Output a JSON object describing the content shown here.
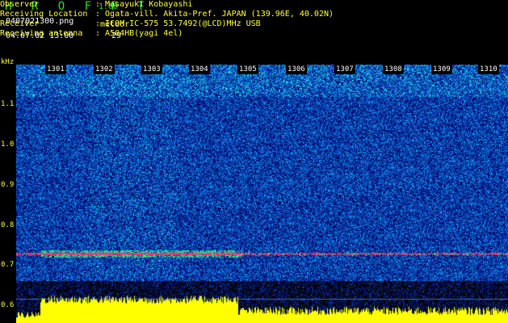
{
  "header": {
    "app_title": "H R O F F T",
    "version": "1.00",
    "filename": "0407021300.png",
    "datetime": "04.07.02 13:00",
    "meteor_label": "meteor",
    "meteor_count": "29"
  },
  "info": [
    {
      "label": "Observer",
      "value": ": Masayuki Kobayashi"
    },
    {
      "label": "Receiving Location",
      "value": ": Ogata-vill. Akita-Pref. JAPAN (139.96E, 40.02N)"
    },
    {
      "label": "Receiver",
      "value": ": ICOM IC-575 53.7492(@LCD)MHz USB"
    },
    {
      "label": "Receiving antenna",
      "value": ": A504HB(yagi 4el)"
    }
  ],
  "axis": {
    "y_unit": "kHz",
    "y_ticks": [
      "1.1",
      "1.0",
      "0.9",
      "0.8",
      "0.7",
      "0.6"
    ],
    "x_ticks": [
      "1301",
      "1302",
      "1303",
      "1304",
      "1305",
      "1306",
      "1307",
      "1308",
      "1309",
      "1310"
    ]
  },
  "colors": {
    "background": "#000000",
    "text_yellow": "#ffff40",
    "text_green": "#28e028",
    "signal_peak": "#ff2d6e"
  }
}
